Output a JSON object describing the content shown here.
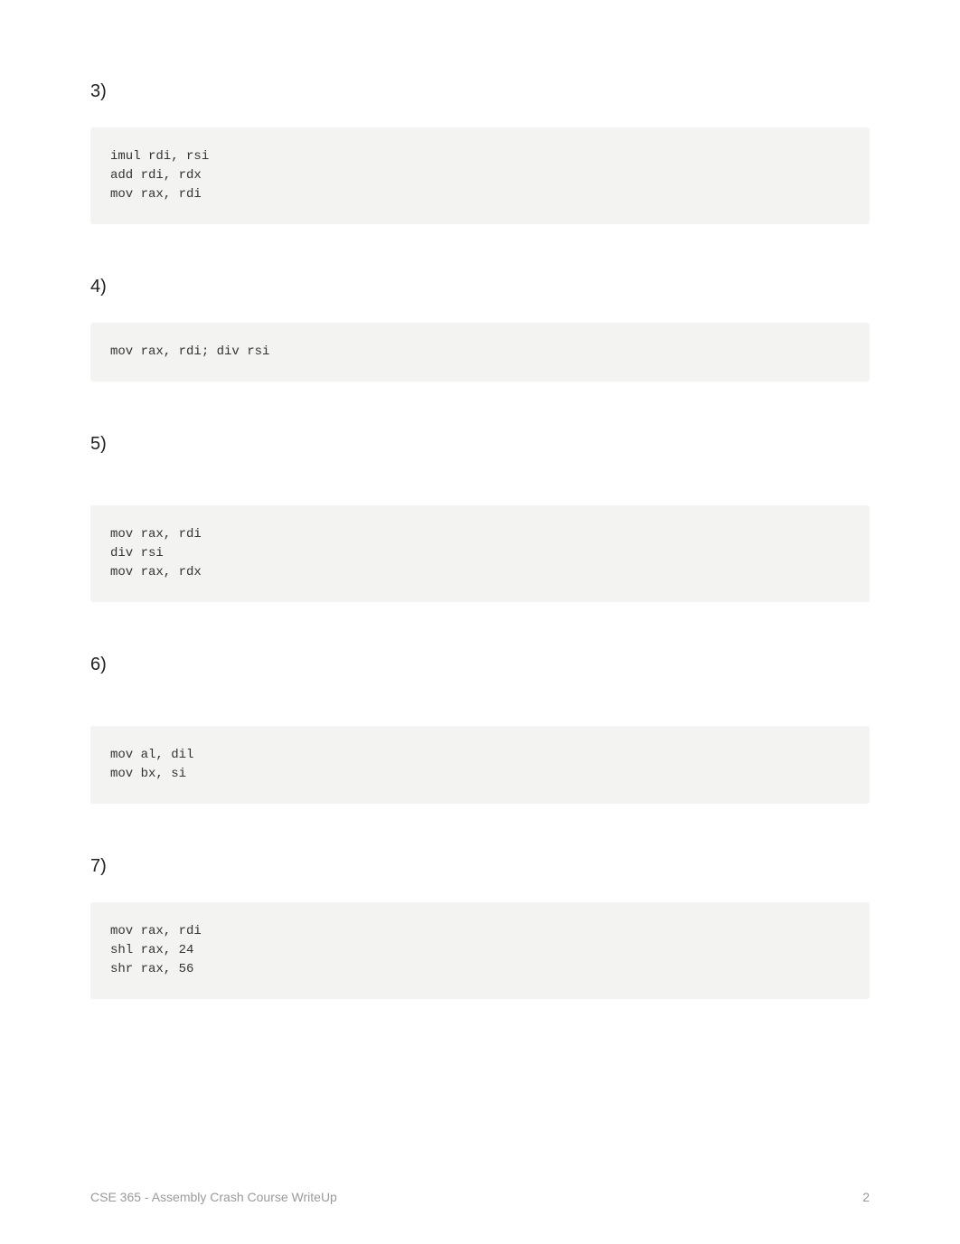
{
  "sections": [
    {
      "heading": "3)",
      "code": "imul rdi, rsi\nadd rdi, rdx\nmov rax, rdi"
    },
    {
      "heading": "4)",
      "code": "mov rax, rdi; div rsi"
    },
    {
      "heading": "5)",
      "code": "mov rax, rdi\ndiv rsi\nmov rax, rdx"
    },
    {
      "heading": "6)",
      "code": "mov al, dil\nmov bx, si"
    },
    {
      "heading": "7)",
      "code": "mov rax, rdi\nshl rax, 24\nshr rax, 56"
    }
  ],
  "footer": {
    "title": "CSE 365 - Assembly Crash Course WriteUp",
    "page": "2"
  }
}
